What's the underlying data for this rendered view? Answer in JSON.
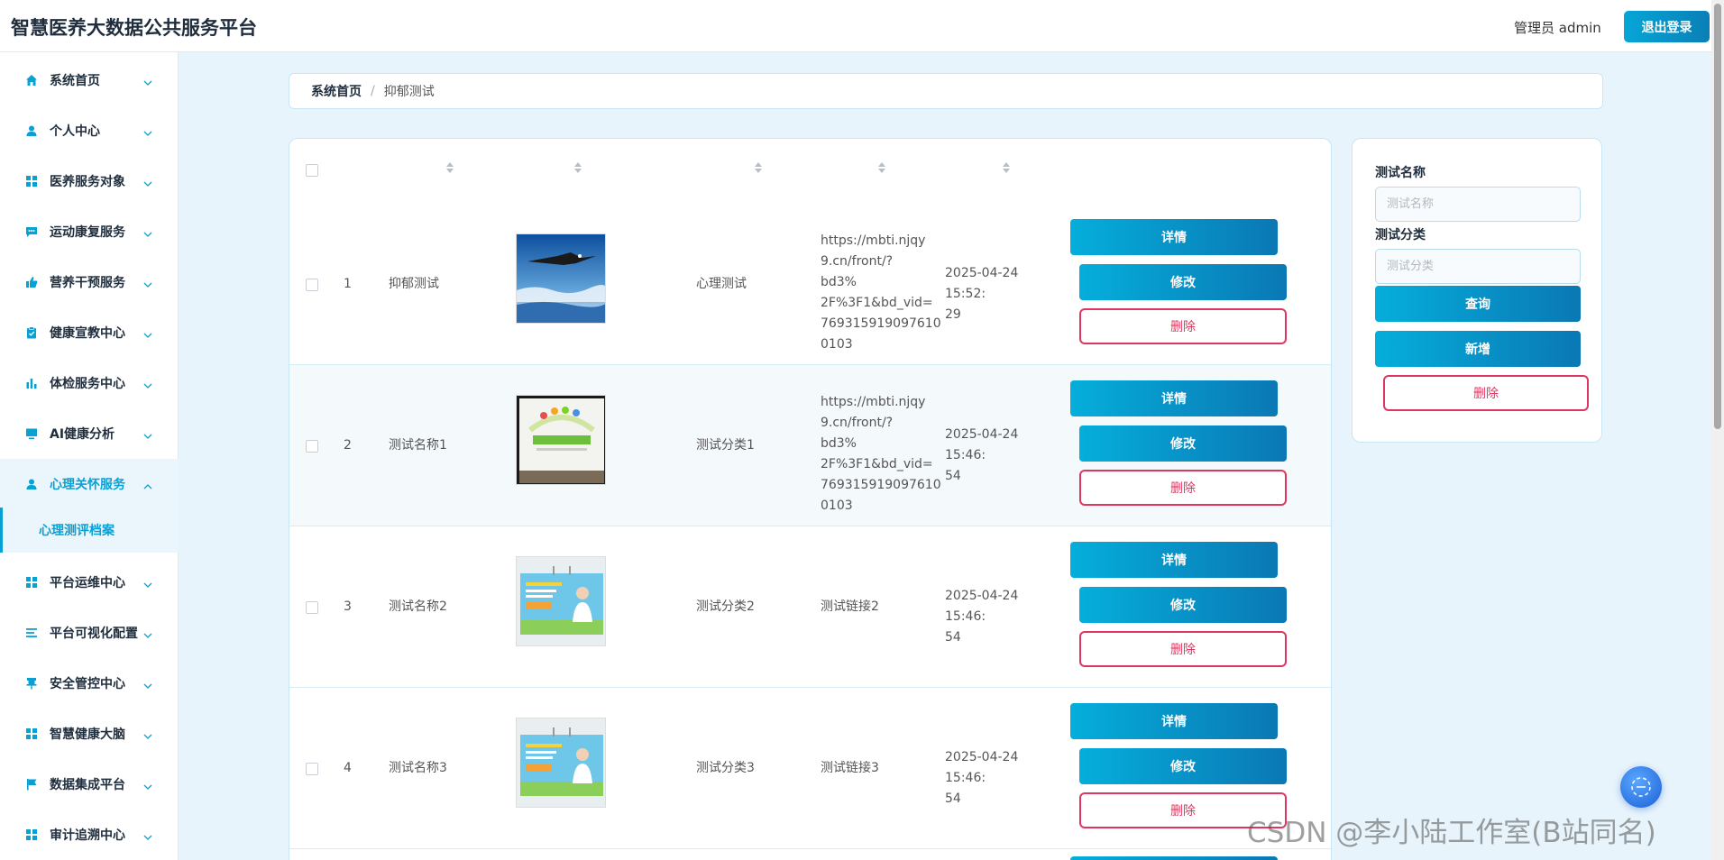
{
  "header": {
    "title": "智慧医养大数据公共服务平台",
    "admin_label": "管理员 admin",
    "logout_label": "退出登录"
  },
  "sidebar": {
    "items": [
      {
        "label": "系统首页",
        "icon": "home-icon"
      },
      {
        "label": "个人中心",
        "icon": "user-icon"
      },
      {
        "label": "医养服务对象",
        "icon": "grid-icon"
      },
      {
        "label": "运动康复服务",
        "icon": "chat-icon"
      },
      {
        "label": "营养干预服务",
        "icon": "thumb-icon"
      },
      {
        "label": "健康宣教中心",
        "icon": "clipboard-icon"
      },
      {
        "label": "体检服务中心",
        "icon": "bar-chart-icon"
      },
      {
        "label": "AI健康分析",
        "icon": "monitor-icon"
      },
      {
        "label": "心理关怀服务",
        "icon": "user-icon"
      },
      {
        "label": "平台运维中心",
        "icon": "grid-icon"
      },
      {
        "label": "平台可视化配置",
        "icon": "list-icon"
      },
      {
        "label": "安全管控中心",
        "icon": "pin-icon"
      },
      {
        "label": "智慧健康大脑",
        "icon": "grid-icon"
      },
      {
        "label": "数据集成平台",
        "icon": "flag-icon"
      },
      {
        "label": "审计追溯中心",
        "icon": "grid-icon"
      }
    ],
    "active_submenu": "心理测评档案"
  },
  "breadcrumb": {
    "home": "系统首页",
    "separator": "/",
    "current": "抑郁测试"
  },
  "table": {
    "rows": [
      {
        "index": "1",
        "name": "抑郁测试",
        "category": "心理测试",
        "link": "https://mbti.njqy9.cn/front/?bd3%2F%3F1&bd_vid=7693159190976100103",
        "link_lines": [
          "https://mbti.njqy",
          "9.cn/front/?bd3%",
          "2F%3F1&bd_vid=",
          "769315919097610",
          "0103"
        ],
        "time_lines": [
          "2025-04-24 15:52:",
          "29"
        ],
        "image": "eagle-image"
      },
      {
        "index": "2",
        "name": "测试名称1",
        "category": "测试分类1",
        "link": "https://mbti.njqy9.cn/front/?bd3%2F%3F1&bd_vid=7693159190976100103",
        "link_lines": [
          "https://mbti.njqy",
          "9.cn/front/?bd3%",
          "2F%3F1&bd_vid=",
          "769315919097610",
          "0103"
        ],
        "time_lines": [
          "2025-04-24 15:46:",
          "54"
        ],
        "image": "wall-image"
      },
      {
        "index": "3",
        "name": "测试名称2",
        "category": "测试分类2",
        "link": "测试链接2",
        "link_lines": [
          "测试链接2"
        ],
        "time_lines": [
          "2025-04-24 15:46:",
          "54"
        ],
        "image": "poster-image"
      },
      {
        "index": "4",
        "name": "测试名称3",
        "category": "测试分类3",
        "link": "测试链接3",
        "link_lines": [
          "测试链接3"
        ],
        "time_lines": [
          "2025-04-24 15:46:",
          "54"
        ],
        "image": "poster-image"
      }
    ],
    "detail_label": "详情",
    "edit_label": "修改",
    "delete_label": "删除"
  },
  "search": {
    "name_label": "测试名称",
    "name_placeholder": "测试名称",
    "category_label": "测试分类",
    "category_placeholder": "测试分类",
    "query_label": "查询",
    "add_label": "新增",
    "delete_label": "删除"
  },
  "watermark": "CSDN @李小陆工作室(B站同名)",
  "colors": {
    "accent": "#09a0d4",
    "danger": "#e0355f",
    "background": "#e8f4fb"
  }
}
